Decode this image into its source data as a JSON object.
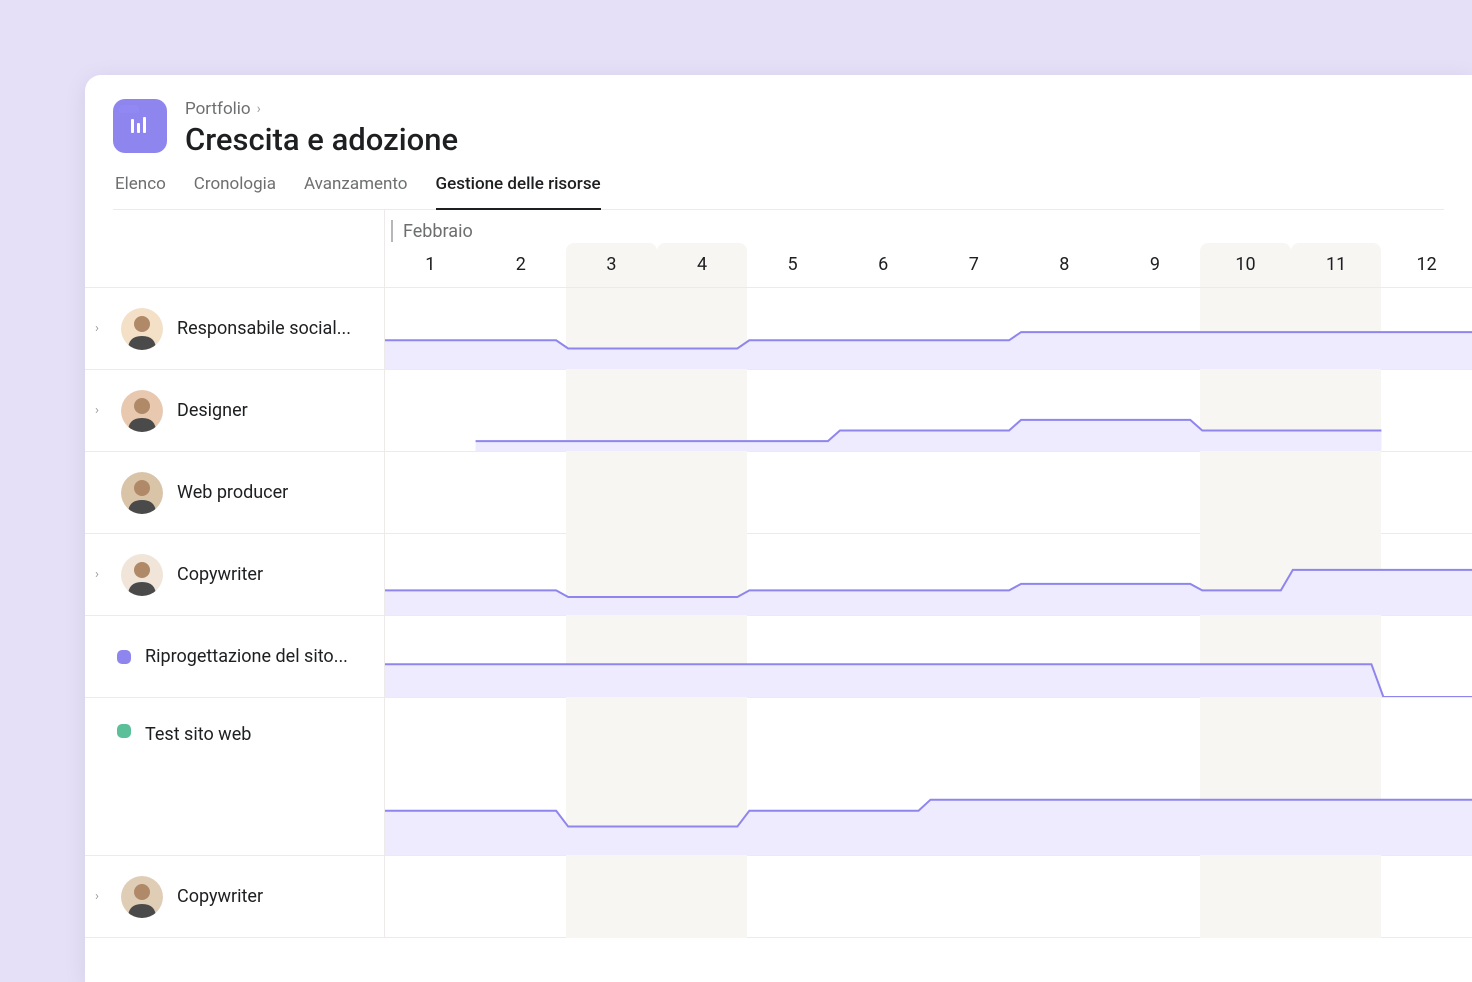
{
  "breadcrumb": "Portfolio",
  "title": "Crescita e adozione",
  "tabs": [
    {
      "label": "Elenco",
      "active": false
    },
    {
      "label": "Cronologia",
      "active": false
    },
    {
      "label": "Avanzamento",
      "active": false
    },
    {
      "label": "Gestione delle risorse",
      "active": true
    }
  ],
  "month": "Febbraio",
  "days": [
    {
      "n": "1",
      "shaded": false
    },
    {
      "n": "2",
      "shaded": false
    },
    {
      "n": "3",
      "shaded": true
    },
    {
      "n": "4",
      "shaded": true
    },
    {
      "n": "5",
      "shaded": false
    },
    {
      "n": "6",
      "shaded": false
    },
    {
      "n": "7",
      "shaded": false
    },
    {
      "n": "8",
      "shaded": false
    },
    {
      "n": "9",
      "shaded": false
    },
    {
      "n": "10",
      "shaded": true
    },
    {
      "n": "11",
      "shaded": true
    },
    {
      "n": "12",
      "shaded": false
    }
  ],
  "rows": [
    {
      "type": "person",
      "label": "Responsabile social...",
      "avatar_bg": "#f3e0c7",
      "expandable": true
    },
    {
      "type": "person",
      "label": "Designer",
      "avatar_bg": "#e8c9b0",
      "expandable": true
    },
    {
      "type": "person",
      "label": "Web producer",
      "avatar_bg": "#d9c4a8",
      "expandable": false
    },
    {
      "type": "person",
      "label": "Copywriter",
      "avatar_bg": "#f0e5d8",
      "expandable": true
    },
    {
      "type": "task",
      "label": "Riprogettazione del sito...",
      "color": "purple"
    },
    {
      "type": "task",
      "label": "Test sito web",
      "color": "green"
    },
    {
      "type": "person",
      "label": "Copywriter",
      "avatar_bg": "#e0cdb5",
      "expandable": true
    }
  ],
  "colors": {
    "accent": "#8f85ee",
    "fill": "#edebfd"
  }
}
